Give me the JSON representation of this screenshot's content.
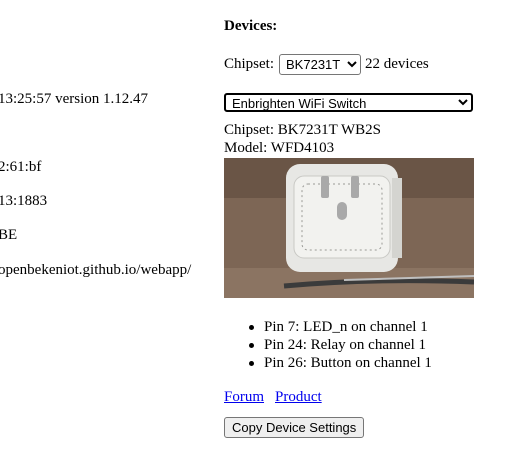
{
  "left_panel": {
    "lines": [
      "13:25:57 version 1.12.47",
      "2:61:bf",
      "13:1883",
      "BE",
      "openbekeniot.github.io/webapp/"
    ]
  },
  "devices": {
    "heading": "Devices:",
    "chipset_label": "Chipset:",
    "chipset_selected": "BK7231T",
    "device_count": "22 devices",
    "device_selected": "Enbrighten WiFi Switch",
    "chipset_info": "Chipset: BK7231T WB2S",
    "model_info": "Model: WFD4103",
    "photo_icon": "smart-plug-photo",
    "pins": [
      "Pin 7: LED_n on channel 1",
      "Pin 24: Relay on channel 1",
      "Pin 26: Button on channel 1"
    ],
    "forum_link": "Forum",
    "product_link": "Product",
    "copy_button": "Copy Device Settings"
  }
}
